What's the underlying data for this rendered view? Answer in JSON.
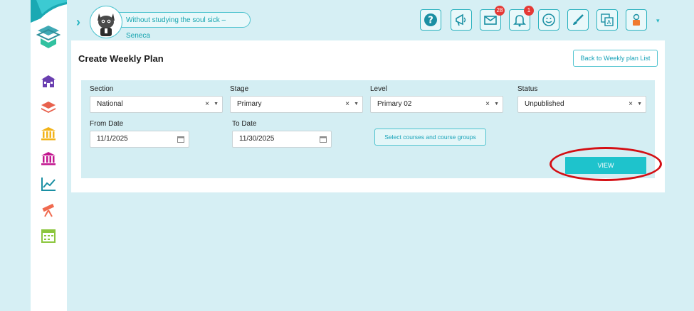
{
  "app": {
    "quote": "Without studying the soul sick – Seneca"
  },
  "toolbar": {
    "buttons": [
      {
        "name": "help-icon"
      },
      {
        "name": "megaphone-icon"
      },
      {
        "name": "mail-icon",
        "badge": "28"
      },
      {
        "name": "bell-icon",
        "badge": "1"
      },
      {
        "name": "smiley-icon"
      },
      {
        "name": "brush-icon"
      },
      {
        "name": "translate-icon"
      },
      {
        "name": "user-profile-icon"
      }
    ],
    "caret": "▾"
  },
  "sidebar": {
    "icons": [
      "school-icon",
      "layers-icon",
      "institution-icon",
      "building-columns-icon",
      "chart-line-icon",
      "telescope-icon",
      "calendar-icon"
    ]
  },
  "page": {
    "title": "Create Weekly Plan",
    "back_button": "Back to Weekly plan List"
  },
  "filters": {
    "section": {
      "label": "Section",
      "value": "National"
    },
    "stage": {
      "label": "Stage",
      "value": "Primary"
    },
    "level": {
      "label": "Level",
      "value": "Primary 02"
    },
    "status": {
      "label": "Status",
      "value": "Unpublished"
    },
    "from_date": {
      "label": "From Date",
      "value": "11/1/2025"
    },
    "to_date": {
      "label": "To Date",
      "value": "11/30/2025"
    },
    "clear_glyph": "×",
    "arrow_glyph": "▼",
    "select_courses_button": "Select courses and course groups",
    "view_button": "VIEW"
  },
  "colors": {
    "accent": "#1ec3cc",
    "background": "#d6eff4",
    "highlight": "#d40f14"
  }
}
